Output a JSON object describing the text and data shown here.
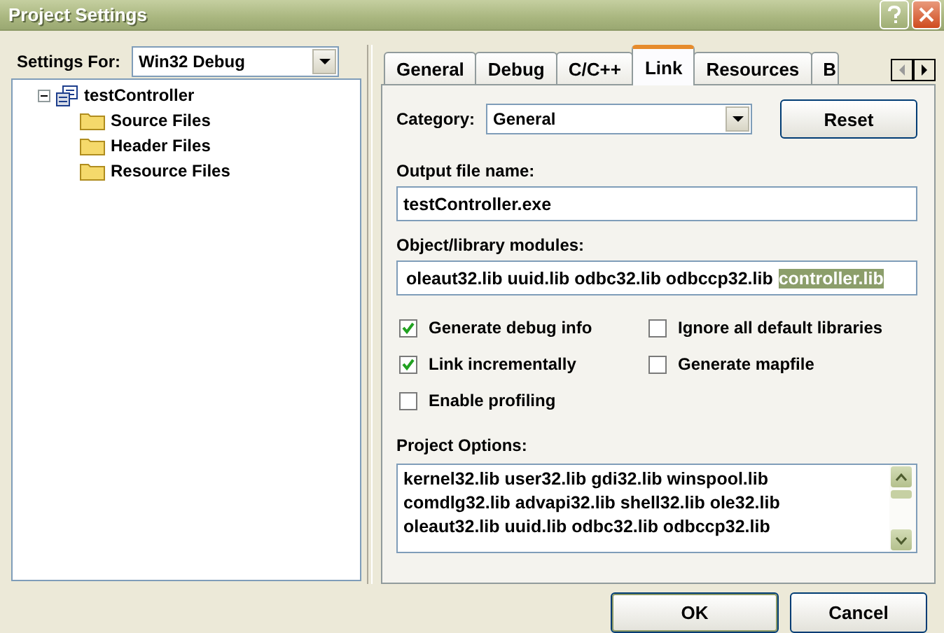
{
  "window": {
    "title": "Project Settings"
  },
  "settings_for": {
    "label": "Settings For:",
    "value": "Win32 Debug"
  },
  "tree": [
    {
      "label": "testController",
      "expanded": true,
      "children": [
        {
          "label": "Source Files"
        },
        {
          "label": "Header Files"
        },
        {
          "label": "Resource Files"
        }
      ]
    }
  ],
  "tabs": [
    {
      "label": "General",
      "selected": false
    },
    {
      "label": "Debug",
      "selected": false
    },
    {
      "label": "C/C++",
      "selected": false
    },
    {
      "label": "Link",
      "selected": true
    },
    {
      "label": "Resources",
      "selected": false
    },
    {
      "label": "B",
      "selected": false
    }
  ],
  "category": {
    "label": "Category:",
    "value": "General"
  },
  "reset_button": "Reset",
  "output_file": {
    "label": "Output file name:",
    "value": "testController.exe"
  },
  "modules": {
    "label": "Object/library modules:",
    "segments": [
      {
        "text": "oleaut32.lib uuid.lib odbc32.lib odbccp32.lib",
        "selected": false
      },
      {
        "text": "controller.lib",
        "selected": true
      }
    ]
  },
  "checkboxes": [
    {
      "label": "Generate debug info",
      "checked": true
    },
    {
      "label": "Ignore all default libraries",
      "checked": false
    },
    {
      "label": "Link incrementally",
      "checked": true
    },
    {
      "label": "Generate mapfile",
      "checked": false
    },
    {
      "label": "Enable profiling",
      "checked": false
    }
  ],
  "project_options": {
    "label": "Project Options:",
    "lines": [
      "kernel32.lib user32.lib gdi32.lib winspool.lib",
      "comdlg32.lib advapi32.lib shell32.lib ole32.lib",
      "oleaut32.lib uuid.lib odbc32.lib odbccp32.lib"
    ]
  },
  "buttons": [
    "OK",
    "Cancel"
  ]
}
